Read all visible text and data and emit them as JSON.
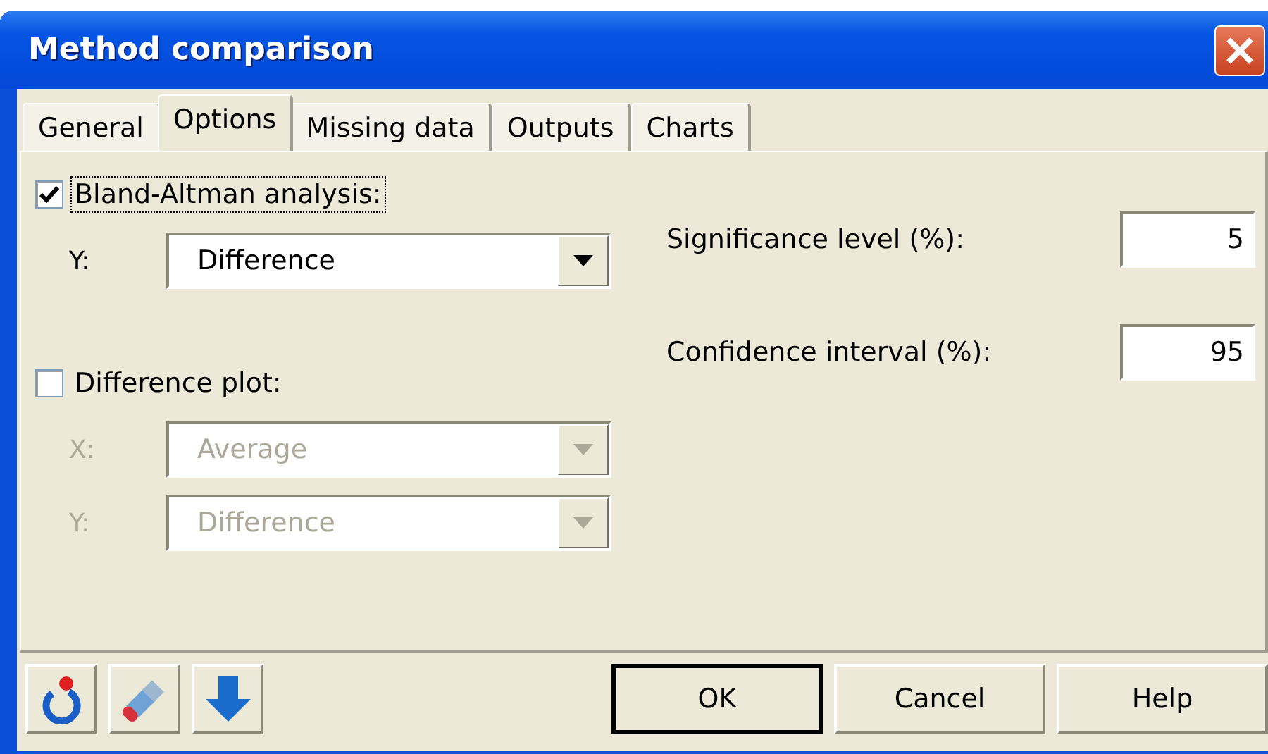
{
  "window": {
    "title": "Method comparison"
  },
  "tabs": [
    {
      "label": "General",
      "selected": false
    },
    {
      "label": "Options",
      "selected": true
    },
    {
      "label": "Missing data",
      "selected": false
    },
    {
      "label": "Outputs",
      "selected": false
    },
    {
      "label": "Charts",
      "selected": false
    }
  ],
  "groups": [
    {
      "label": "Bland-Altman analysis:",
      "checked": true,
      "focused": true,
      "selects": [
        {
          "label": "Y:",
          "value": "Difference",
          "disabled": false
        }
      ]
    },
    {
      "label": "Difference plot:",
      "checked": false,
      "focused": false,
      "selects": [
        {
          "label": "X:",
          "value": "Average",
          "disabled": true
        },
        {
          "label": "Y:",
          "value": "Difference",
          "disabled": true
        }
      ]
    }
  ],
  "fields": [
    {
      "label": "Significance level (%):",
      "value": "5"
    },
    {
      "label": "Confidence interval (%):",
      "value": "95"
    }
  ],
  "tools": [
    {
      "kind": "reset"
    },
    {
      "kind": "eraser"
    },
    {
      "kind": "down"
    }
  ],
  "buttons": [
    {
      "label": "OK",
      "default": true
    },
    {
      "label": "Cancel",
      "default": false
    },
    {
      "label": "Help",
      "default": false
    }
  ]
}
